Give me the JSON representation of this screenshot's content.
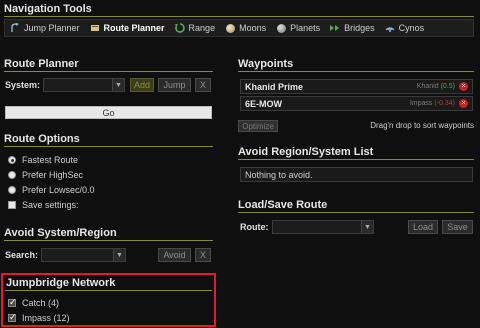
{
  "nav": {
    "title": "Navigation Tools",
    "items": [
      {
        "label": "Jump Planner",
        "icon": "jump-icon"
      },
      {
        "label": "Route Planner",
        "icon": "route-icon"
      },
      {
        "label": "Range",
        "icon": "range-icon"
      },
      {
        "label": "Moons",
        "icon": "moon-icon"
      },
      {
        "label": "Planets",
        "icon": "planet-icon"
      },
      {
        "label": "Bridges",
        "icon": "bridge-icon"
      },
      {
        "label": "Cynos",
        "icon": "cyno-icon"
      }
    ]
  },
  "route_planner": {
    "title": "Route Planner",
    "system_label": "System:",
    "add_label": "Add",
    "jump_label": "Jump",
    "clear_label": "X",
    "go_label": "Go"
  },
  "route_options": {
    "title": "Route Options",
    "options": [
      "Fastest Route",
      "Prefer HighSec",
      "Prefer Lowsec/0.0"
    ],
    "save_settings": "Save settings:"
  },
  "avoid_system": {
    "title": "Avoid System/Region",
    "search_label": "Search:",
    "avoid_label": "Avoid",
    "clear_label": "X"
  },
  "jumpbridge": {
    "title": "Jumpbridge Network",
    "items": [
      "Catch (4)",
      "Impass (12)"
    ]
  },
  "waypoints": {
    "title": "Waypoints",
    "items": [
      {
        "name": "Khanid Prime",
        "region": "Khanid",
        "sec": "(0.5)",
        "sec_color": "#4caf50"
      },
      {
        "name": "6E-MOW",
        "region": "Impass",
        "sec": "(-0.34)",
        "sec_color": "#c0392b"
      }
    ],
    "optimize_label": "Optimize",
    "hint": "Drag'n drop to sort waypoints"
  },
  "avoid_list": {
    "title": "Avoid Region/System List",
    "empty_text": "Nothing to avoid."
  },
  "load_save": {
    "title": "Load/Save Route",
    "route_label": "Route:",
    "load_label": "Load",
    "save_label": "Save"
  }
}
